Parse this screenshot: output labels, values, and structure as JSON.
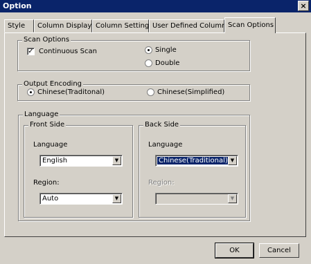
{
  "window": {
    "title": "Option",
    "close_glyph": "×"
  },
  "tabs": [
    {
      "label": "Style"
    },
    {
      "label": "Column Display"
    },
    {
      "label": "Column Setting"
    },
    {
      "label": "User Defined Column"
    },
    {
      "label": "Scan Options",
      "active": true
    }
  ],
  "scan_options": {
    "legend": "Scan Options",
    "continuous_scan": {
      "label": "Continuous Scan",
      "checked": true,
      "mark": "✓"
    },
    "single": {
      "label": "Single",
      "selected": true
    },
    "double": {
      "label": "Double",
      "selected": false
    }
  },
  "output_encoding": {
    "legend": "Output Encoding",
    "traditional": {
      "label": "Chinese(Traditonal)",
      "selected": true
    },
    "simplified": {
      "label": "Chinese(Simplified)",
      "selected": false
    }
  },
  "language": {
    "legend": "Language",
    "front": {
      "legend": "Front Side",
      "language_label": "Language",
      "language_value": "English",
      "region_label": "Region:",
      "region_value": "Auto"
    },
    "back": {
      "legend": "Back Side",
      "language_label": "Language",
      "language_value": "Chinese(Traditional)",
      "region_label": "Region:",
      "region_value": ""
    }
  },
  "buttons": {
    "ok": "OK",
    "cancel": "Cancel"
  },
  "icons": {
    "dropdown": "▼"
  },
  "colors": {
    "titlebar": "#0a246a",
    "face": "#d4d0c8",
    "highlight": "#0a246a"
  }
}
